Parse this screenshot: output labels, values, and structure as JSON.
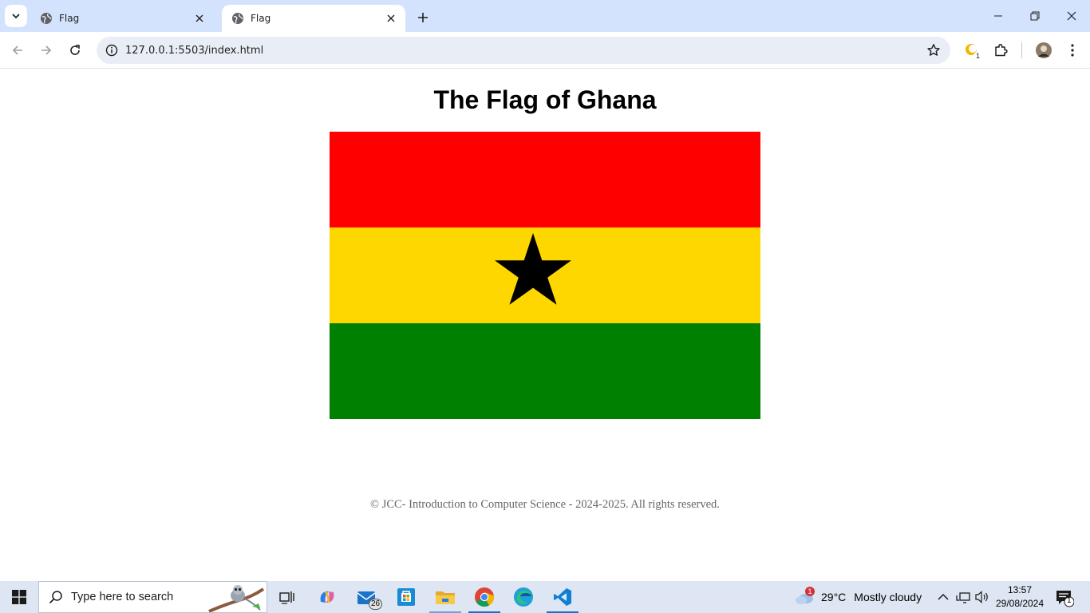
{
  "browser": {
    "tabs": [
      {
        "title": "Flag",
        "active": false
      },
      {
        "title": "Flag",
        "active": true
      }
    ],
    "url": "127.0.0.1:5503/index.html",
    "extension_badge": "1"
  },
  "page": {
    "heading": "The Flag of Ghana",
    "flag_colors": {
      "top": "#ff0000",
      "middle": "#ffd700",
      "bottom": "#008000",
      "star": "#000000"
    },
    "footer": "© JCC- Introduction to Computer Science - 2024-2025. All rights reserved."
  },
  "taskbar": {
    "search_placeholder": "Type here to search",
    "mail_badge": "26",
    "weather_alert": "1",
    "temperature": "29°C",
    "condition": "Mostly cloudy",
    "time": "13:57",
    "date": "29/08/2024",
    "notification_count": "1"
  }
}
